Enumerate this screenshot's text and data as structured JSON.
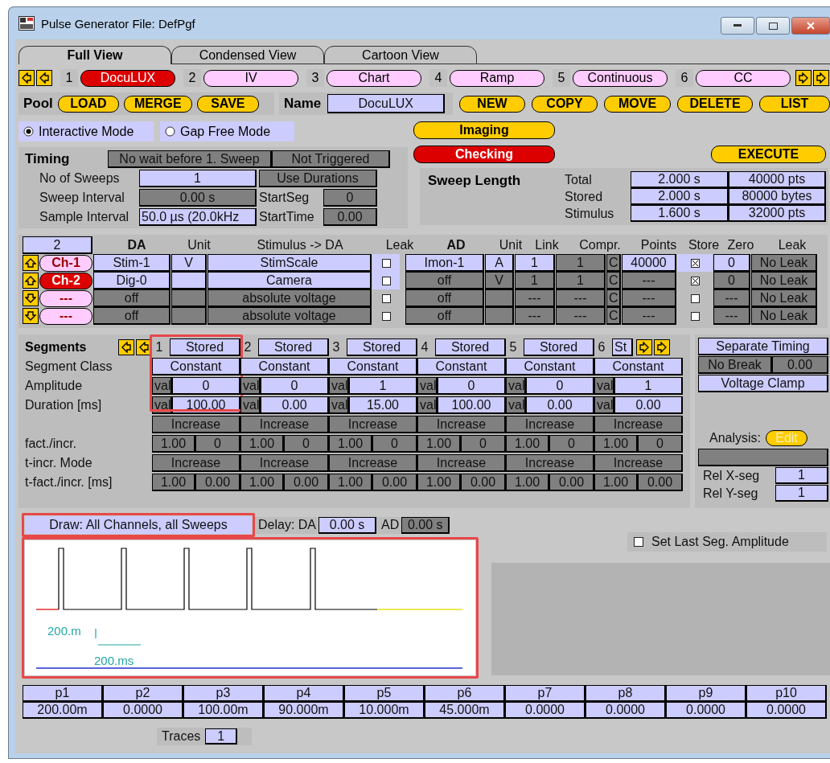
{
  "window": {
    "title": "Pulse Generator File:  DefPgf"
  },
  "view_tabs": [
    {
      "label": "Full View",
      "selected": true
    },
    {
      "label": "Condensed View",
      "selected": false
    },
    {
      "label": "Cartoon View",
      "selected": false
    }
  ],
  "sequences": [
    {
      "number": "1",
      "name": "DocuLUX",
      "selected": true
    },
    {
      "number": "2",
      "name": "IV",
      "selected": false
    },
    {
      "number": "3",
      "name": "Chart",
      "selected": false
    },
    {
      "number": "4",
      "name": "Ramp",
      "selected": false
    },
    {
      "number": "5",
      "name": "Continuous",
      "selected": false
    },
    {
      "number": "6",
      "name": "CC",
      "selected": false
    }
  ],
  "pool": {
    "label": "Pool",
    "buttons": [
      "LOAD",
      "MERGE",
      "SAVE"
    ]
  },
  "name": {
    "label": "Name",
    "value": "DocuLUX",
    "buttons": [
      "NEW",
      "COPY",
      "MOVE",
      "DELETE",
      "LIST"
    ]
  },
  "modes": [
    {
      "label": "Interactive Mode",
      "selected": true
    },
    {
      "label": "Gap Free Mode",
      "selected": false
    }
  ],
  "mode_buttons": [
    {
      "label": "Imaging",
      "active": false
    },
    {
      "label": "Checking",
      "active": true
    }
  ],
  "execute": "EXECUTE",
  "timing": {
    "title": "Timing",
    "wait": "No wait before 1. Sweep",
    "trigger": "Not Triggered",
    "rows": [
      {
        "label": "No of Sweeps",
        "value": "1",
        "editable": true,
        "side_button": "Use Durations"
      },
      {
        "label": "Sweep Interval",
        "value": "0.00 s",
        "editable": false,
        "side_label": "StartSeg",
        "side_value": "0"
      },
      {
        "label": "Sample Interval",
        "value": "50.0 µs  (20.0kHz",
        "editable": true,
        "side_label": "StartTime",
        "side_value": "0.00"
      }
    ]
  },
  "sweep_length": {
    "title": "Sweep Length",
    "rows": [
      {
        "label": "Total",
        "time": "2.000 s",
        "size": "40000 pts"
      },
      {
        "label": "Stored",
        "time": "2.000 s",
        "size": "80000 bytes"
      },
      {
        "label": "Stimulus",
        "time": "1.600 s",
        "size": "32000 pts"
      }
    ]
  },
  "channels": {
    "count": "2",
    "da_headers": [
      "DA",
      "Unit",
      "Stimulus -> DA",
      "Leak"
    ],
    "ad_headers": [
      "AD",
      "Unit",
      "Link",
      "Compr.",
      "Points",
      "Store",
      "Zero",
      "Leak"
    ],
    "rows": [
      {
        "arrow_up": true,
        "name": "Ch-1",
        "selected": false,
        "da_on": true,
        "da": "Stim-1",
        "unit": "V",
        "stimulus": "StimScale",
        "leak": false,
        "ad_on": true,
        "ad": "Imon-1",
        "ad_unit": "A",
        "link": "1",
        "compr": "1",
        "compr_mode": "C",
        "points": "40000",
        "store": true,
        "zero": "0",
        "leak_mode": "No Leak"
      },
      {
        "arrow_up": true,
        "name": "Ch-2",
        "selected": true,
        "da_on": true,
        "da": "Dig-0",
        "unit": "",
        "stimulus": "Camera",
        "leak": false,
        "ad_on": false,
        "ad": "off",
        "ad_unit": "V",
        "link": "1",
        "compr": "1",
        "compr_mode": "C",
        "points": "---",
        "store": true,
        "zero": "0",
        "leak_mode": "No Leak"
      },
      {
        "arrow_up": false,
        "name": "---",
        "selected": false,
        "da_on": false,
        "da": "off",
        "unit": "",
        "stimulus": "absolute voltage",
        "leak": false,
        "ad_on": false,
        "ad": "off",
        "ad_unit": "",
        "link": "---",
        "compr": "---",
        "compr_mode": "C",
        "points": "---",
        "store": false,
        "zero": "---",
        "leak_mode": "No Leak"
      },
      {
        "arrow_up": false,
        "name": "---",
        "selected": false,
        "da_on": false,
        "da": "off",
        "unit": "",
        "stimulus": "absolute voltage",
        "leak": false,
        "ad_on": false,
        "ad": "off",
        "ad_unit": "",
        "link": "---",
        "compr": "---",
        "compr_mode": "C",
        "points": "---",
        "store": false,
        "zero": "---",
        "leak_mode": "No Leak"
      }
    ]
  },
  "segments": {
    "title": "Segments",
    "labels": {
      "class": "Segment Class",
      "amplitude": "Amplitude",
      "duration": "Duration [ms]",
      "fact": "fact./incr.",
      "t_mode": "t-incr. Mode",
      "t_fact": "t-fact./incr. [ms]"
    },
    "columns": [
      {
        "number": "1",
        "storage": "Stored",
        "class": "Constant",
        "amp_mode": "val",
        "amplitude": "0",
        "dur_mode": "val",
        "duration": "100.00",
        "incr_mode": "Increase",
        "fact": "1.00",
        "incr": "0",
        "t_mode": "Increase",
        "t_fact": "1.00",
        "t_incr": "0.00",
        "highlighted": true
      },
      {
        "number": "2",
        "storage": "Stored",
        "class": "Constant",
        "amp_mode": "val",
        "amplitude": "0",
        "dur_mode": "val",
        "duration": "0.00",
        "incr_mode": "Increase",
        "fact": "1.00",
        "incr": "0",
        "t_mode": "Increase",
        "t_fact": "1.00",
        "t_incr": "0.00"
      },
      {
        "number": "3",
        "storage": "Stored",
        "class": "Constant",
        "amp_mode": "val",
        "amplitude": "1",
        "dur_mode": "val",
        "duration": "15.00",
        "incr_mode": "Increase",
        "fact": "1.00",
        "incr": "0",
        "t_mode": "Increase",
        "t_fact": "1.00",
        "t_incr": "0.00"
      },
      {
        "number": "4",
        "storage": "Stored",
        "class": "Constant",
        "amp_mode": "val",
        "amplitude": "0",
        "dur_mode": "val",
        "duration": "100.00",
        "incr_mode": "Increase",
        "fact": "1.00",
        "incr": "0",
        "t_mode": "Increase",
        "t_fact": "1.00",
        "t_incr": "0.00"
      },
      {
        "number": "5",
        "storage": "Stored",
        "class": "Constant",
        "amp_mode": "val",
        "amplitude": "0",
        "dur_mode": "val",
        "duration": "0.00",
        "incr_mode": "Increase",
        "fact": "1.00",
        "incr": "0",
        "t_mode": "Increase",
        "t_fact": "1.00",
        "t_incr": "0.00"
      },
      {
        "number": "6",
        "storage": "St",
        "class": "Constant",
        "amp_mode": "val",
        "amplitude": "1",
        "dur_mode": "val",
        "duration": "0.00",
        "incr_mode": "Increase",
        "fact": "1.00",
        "incr": "0",
        "t_mode": "Increase",
        "t_fact": "1.00",
        "t_incr": "0.00"
      }
    ]
  },
  "segment_options": {
    "separate_timing": "Separate Timing",
    "no_break": "No Break",
    "break_value": "0.00",
    "clamp": "Voltage Clamp",
    "analysis_label": "Analysis:",
    "analysis_button": {
      "label": "Edit",
      "disabled": true
    },
    "rel_x": {
      "label": "Rel X-seg",
      "value": "1"
    },
    "rel_y": {
      "label": "Rel Y-seg",
      "value": "1"
    }
  },
  "draw": {
    "label": "Draw: All Channels, all Sweeps",
    "highlighted": true,
    "delay_label": "Delay: DA",
    "delay_da": "0.00 s",
    "ad_label": "AD",
    "delay_ad": "0.00 s"
  },
  "plot": {
    "y_scale": "200.m",
    "x_scale": "200.ms",
    "highlighted": true
  },
  "set_last_seg": {
    "label": "Set Last Seg. Amplitude",
    "checked": false
  },
  "params": [
    {
      "name": "p1",
      "value": "200.00m"
    },
    {
      "name": "p2",
      "value": "0.0000"
    },
    {
      "name": "p3",
      "value": "100.00m"
    },
    {
      "name": "p4",
      "value": "90.000m"
    },
    {
      "name": "p5",
      "value": "10.000m"
    },
    {
      "name": "p6",
      "value": "45.000m"
    },
    {
      "name": "p7",
      "value": "0.0000"
    },
    {
      "name": "p8",
      "value": "0.0000"
    },
    {
      "name": "p9",
      "value": "0.0000"
    },
    {
      "name": "p10",
      "value": "0.0000"
    }
  ],
  "traces": {
    "label": "Traces",
    "value": "1"
  }
}
